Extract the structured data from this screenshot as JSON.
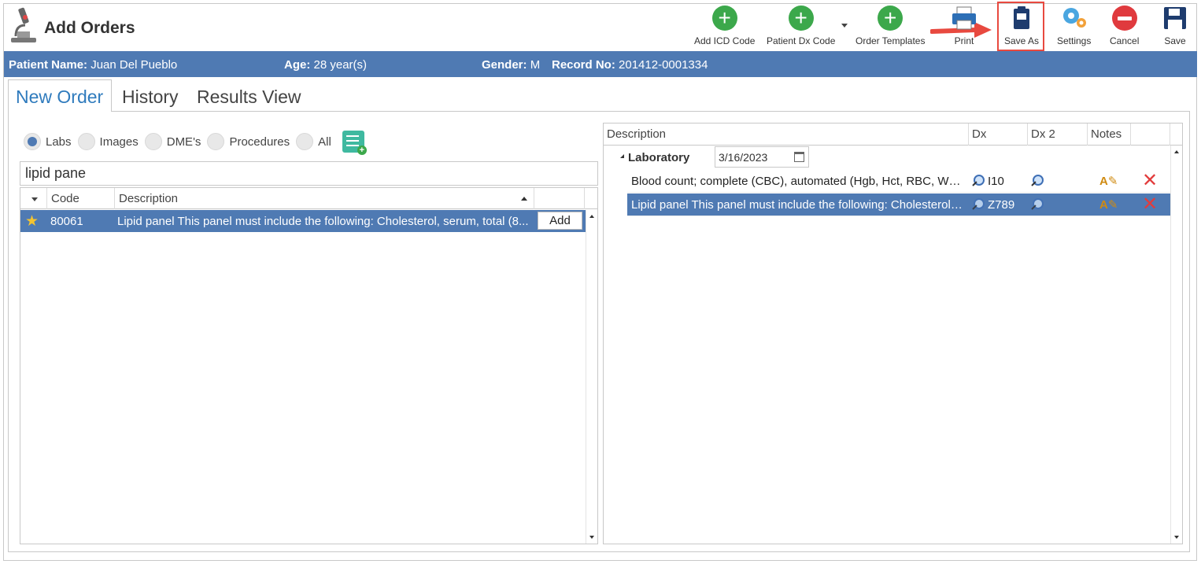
{
  "header": {
    "title": "Add Orders",
    "toolbar": {
      "add_icd": "Add ICD Code",
      "patient_dx": "Patient Dx Code",
      "order_templates": "Order Templates",
      "print": "Print",
      "save_as": "Save As",
      "settings": "Settings",
      "cancel": "Cancel",
      "save": "Save"
    }
  },
  "patient": {
    "name_label": "Patient Name:",
    "name": "Juan Del Pueblo",
    "age_label": "Age:",
    "age": "28 year(s)",
    "gender_label": "Gender:",
    "gender": "M",
    "record_label": "Record No:",
    "record": "201412-0001334"
  },
  "tabs": [
    "New Order",
    "History",
    "Results View"
  ],
  "filters": {
    "options": [
      "Labs",
      "Images",
      "DME's",
      "Procedures",
      "All"
    ],
    "selected": "Labs"
  },
  "search": {
    "value": "lipid pane"
  },
  "left_grid": {
    "columns": [
      "Code",
      "Description"
    ],
    "rows": [
      {
        "code": "80061",
        "description": "Lipid panel This panel must include the following: Cholesterol, serum, total (8...",
        "action": "Add"
      }
    ]
  },
  "right_grid": {
    "columns": [
      "Description",
      "Dx",
      "Dx 2",
      "Notes"
    ],
    "group": {
      "label": "Laboratory",
      "date": "3/16/2023"
    },
    "rows": [
      {
        "description": "Blood count; complete (CBC), automated (Hgb, Hct, RBC, WB...",
        "dx": "I10",
        "selected": false
      },
      {
        "description": "Lipid panel This panel must include the following: Cholesterol,...",
        "dx": "Z789",
        "selected": true
      }
    ]
  },
  "colors": {
    "accent": "#4f7ab3",
    "tab_active": "#2f7bbd",
    "add_green": "#3ca84b",
    "cancel_red": "#e03a3e",
    "highlight": "#e8493f"
  }
}
